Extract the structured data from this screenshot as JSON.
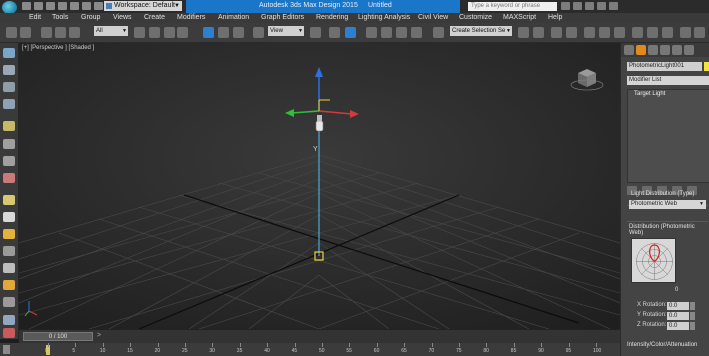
{
  "title_bar": {
    "workspace": "Workspace: Default",
    "app_title": "Autodesk 3ds Max Design 2015",
    "document": "Untitled",
    "search_placeholder": "Type a keyword or phrase"
  },
  "menu": [
    "Edit",
    "Tools",
    "Group",
    "Views",
    "Create",
    "Modifiers",
    "Animation",
    "Graph Editors",
    "Rendering",
    "Lighting Analysis",
    "Civil View",
    "Customize",
    "MAXScript",
    "Help"
  ],
  "toolbar": {
    "selection_filter": "All",
    "reference_coord": "View",
    "named_selection": "Create Selection Se"
  },
  "viewport": {
    "label": "[+] [Perspective ] [Shaded ]",
    "gizmo_colors": {
      "x": "#d23b3b",
      "y": "#2fbf3a",
      "z": "#2f6fe0"
    },
    "light_color": "#f0d23a"
  },
  "command_panel": {
    "object_name": "PhotometricLight001",
    "modifier_list": "Modifier List",
    "stack_item": "Target Light",
    "light_distribution_title": "Light Distribution (Type)",
    "light_distribution_value": "Photometric Web",
    "distribution_title": "Distribution (Photometric Web)",
    "web_value": "0",
    "x_rotation_label": "X Rotation:",
    "x_rotation_value": "0.0",
    "y_rotation_label": "Y Rotation:",
    "y_rotation_value": "0.0",
    "z_rotation_label": "Z Rotation:",
    "z_rotation_value": "0.0",
    "intensity_rollout": "Intensity/Color/Attenuation"
  },
  "time_slider": {
    "frame": "0 / 100"
  },
  "track_bar": {
    "ticks": [
      "0",
      "5",
      "10",
      "15",
      "20",
      "25",
      "30",
      "35",
      "40",
      "45",
      "50",
      "55",
      "60",
      "65",
      "70",
      "75",
      "80",
      "85",
      "90",
      "95",
      "100"
    ]
  }
}
